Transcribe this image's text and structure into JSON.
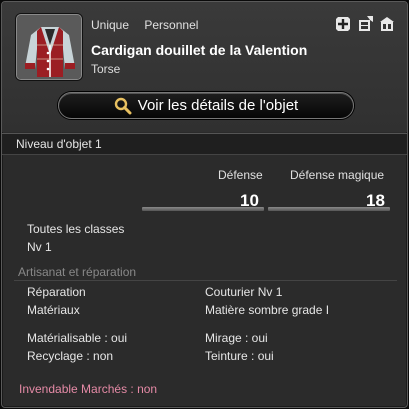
{
  "item": {
    "tag_unique": "Unique",
    "tag_personal": "Personnel",
    "name": "Cardigan douillet de la Valention",
    "slot": "Torse",
    "icon": "cardigan-garment-icon"
  },
  "header_icons": [
    "plus-cross-icon",
    "armoire-storage-icon",
    "glamour-dresser-icon"
  ],
  "details_button": {
    "label": "Voir les détails de l'objet",
    "icon": "magnifier-icon"
  },
  "item_level": "Niveau d'objet 1",
  "stats": {
    "defense_label": "Défense",
    "defense_value": "10",
    "magic_defense_label": "Défense magique",
    "magic_defense_value": "18"
  },
  "requirements": {
    "classes": "Toutes les classes",
    "level": "Nv 1"
  },
  "crafting": {
    "title": "Artisanat et réparation",
    "repair_label": "Réparation",
    "repair_value": "Couturier Nv 1",
    "materials_label": "Matériaux",
    "materials_value": "Matière sombre grade I",
    "materialize": "Matérialisable : oui",
    "mirage": "Mirage : oui",
    "recycle": "Recyclage : non",
    "dye": "Teinture : oui"
  },
  "market": "Invendable Marchés : non",
  "colors": {
    "unsellable_text": "#e58aa6",
    "section_title": "#888888"
  }
}
